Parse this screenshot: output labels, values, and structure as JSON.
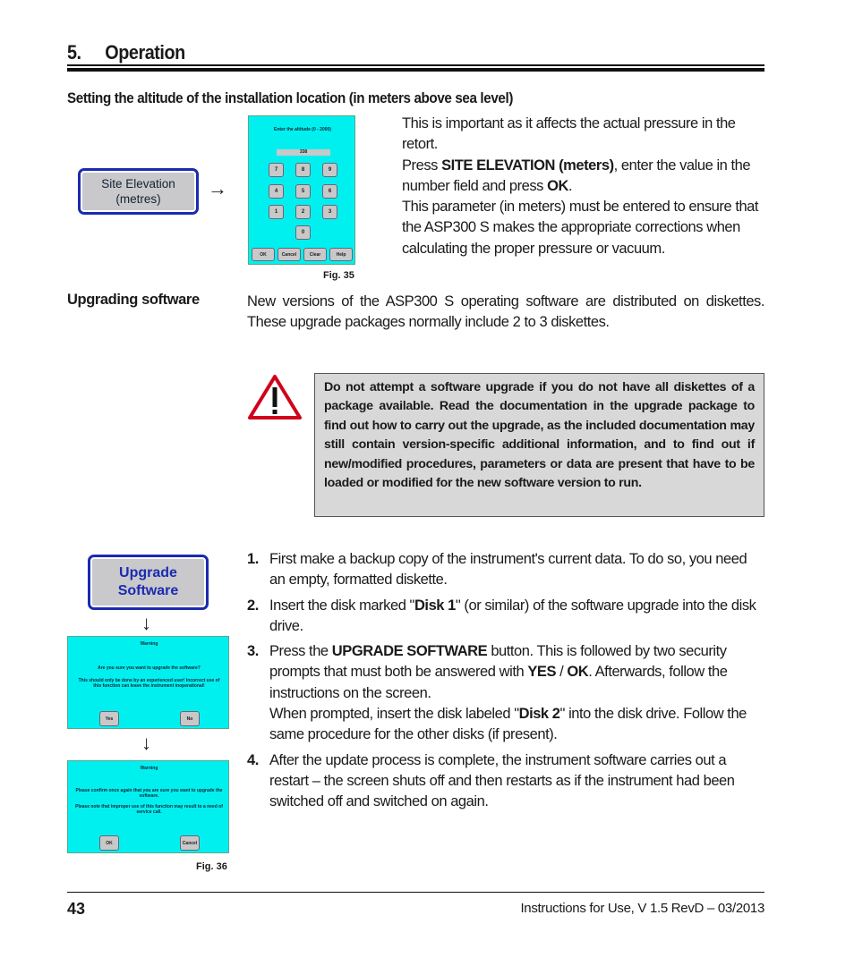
{
  "header": {
    "section_number": "5.",
    "section_title": "Operation"
  },
  "altitude": {
    "heading": "Setting the altitude of the installation location (in meters above sea level)",
    "button_label_1": "Site Elevation",
    "button_label_2": "(metres)",
    "arrow": "→",
    "screen": {
      "prompt": "Enter the altitude (0 - 2000)",
      "value": "338",
      "keys": [
        "7",
        "8",
        "9",
        "4",
        "5",
        "6",
        "1",
        "2",
        "3",
        "0"
      ],
      "buttons": [
        "OK",
        "Cancel",
        "Clear",
        "Help"
      ]
    },
    "figure": "Fig. 35",
    "p1": "This is important as it affects the actual pressure in the retort.",
    "p2_a": "Press ",
    "p2_b": "SITE ELEVATION (meters)",
    "p2_c": ", enter the value in the number field and press ",
    "p2_d": "OK",
    "p2_e": ".",
    "p3": "This parameter (in meters) must be entered to ensure that the ASP300 S makes the appropriate corrections when calculating the proper pressure or vacuum."
  },
  "upgrade": {
    "side_heading": "Upgrading software",
    "intro": "New versions of the ASP300 S operating software are distributed on diskettes. These upgrade packages normally include 2 to 3 diskettes.",
    "warning": "Do not attempt a software upgrade if you do not have all diskettes of a package available. Read the documentation in the upgrade package to find out how to carry out the upgrade, as the included documentation may still contain version-specific additional information, and to find out if new/modified procedures, parameters or data are present that have to be loaded or modified for the new software version to run.",
    "button_label_1": "Upgrade",
    "button_label_2": "Software",
    "arrow": "↓",
    "dialog1": {
      "title": "Warning",
      "line1": "Are you sure you want to upgrade the software?",
      "line2": "This should only be done by an experienced user! Incorrect use of this function can leave the instrument inoperational!",
      "yes": "Yes",
      "no": "No"
    },
    "dialog2": {
      "title": "Warning",
      "line1": "Please confirm once again that you are sure you want to upgrade the software.",
      "line2": "Please note that improper use of this function may result to a need of service call.",
      "ok": "OK",
      "cancel": "Cancel"
    },
    "figure": "Fig. 36",
    "steps": [
      {
        "n": "1.",
        "parts": [
          "First make a backup copy of the instrument's current data. To do so, you need an empty, formatted diskette."
        ]
      },
      {
        "n": "2.",
        "a": "Insert the disk marked \"",
        "b": "Disk 1",
        "c": "\" (or similar) of the software upgrade into the disk drive."
      },
      {
        "n": "3.",
        "a": "Press the ",
        "b": "UPGRADE SOFTWARE",
        "c": " button. This is followed by two security prompts that must both be answered with ",
        "d": "YES",
        "e": " / ",
        "f": "OK",
        "g": ". Afterwards, follow the instructions on the screen.",
        "h": "When prompted, insert the disk labeled \"",
        "i": "Disk 2",
        "j": "\" into the disk drive. Follow the same procedure for the other disks (if present)."
      },
      {
        "n": "4.",
        "parts": [
          "After the update process is complete, the instrument software carries out a restart – the screen shuts off and then restarts as if the instrument had been switched off and switched on again."
        ]
      }
    ]
  },
  "footer": {
    "page": "43",
    "doc": "Instructions for Use, V 1.5 RevD – 03/2013"
  },
  "colors": {
    "screen": "#00f0f0",
    "button_border": "#1a2bb0",
    "warning_red": "#d0021b",
    "warning_box": "#d8d8d8"
  }
}
